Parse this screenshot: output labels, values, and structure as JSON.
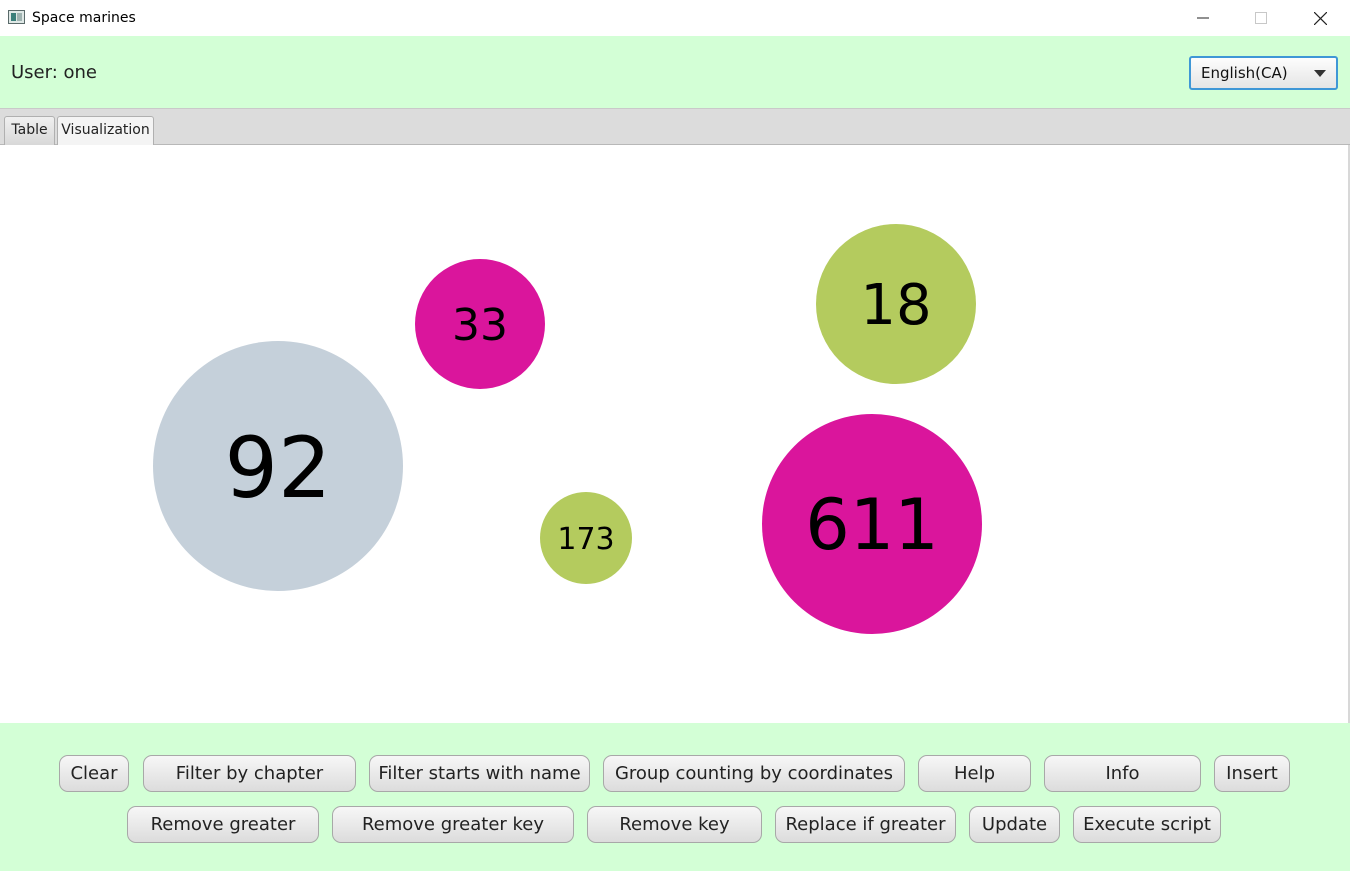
{
  "window": {
    "title": "Space marines",
    "controls": {
      "minimize_icon": "minimize-icon",
      "maximize_icon": "maximize-icon",
      "close_icon": "close-icon"
    }
  },
  "header": {
    "user_label": "User: one",
    "language_select": {
      "selected": "English(CA)"
    },
    "background_color": "#d3ffd6"
  },
  "tabs": [
    {
      "label": "Table",
      "active": false
    },
    {
      "label": "Visualization",
      "active": true
    }
  ],
  "visualization": {
    "objects": [
      {
        "label": "92",
        "color": "#c5d0da"
      },
      {
        "label": "33",
        "color": "#da159c"
      },
      {
        "label": "18",
        "color": "#b4cb5e"
      },
      {
        "label": "173",
        "color": "#b4cb5e"
      },
      {
        "label": "611",
        "color": "#da159c"
      }
    ]
  },
  "commands": {
    "row1": [
      "Clear",
      "Filter by chapter",
      "Filter starts with name",
      "Group counting by coordinates",
      "Help",
      "Info",
      "Insert"
    ],
    "row2": [
      "Remove greater",
      "Remove greater key",
      "Remove key",
      "Replace if greater",
      "Update",
      "Execute script"
    ]
  }
}
